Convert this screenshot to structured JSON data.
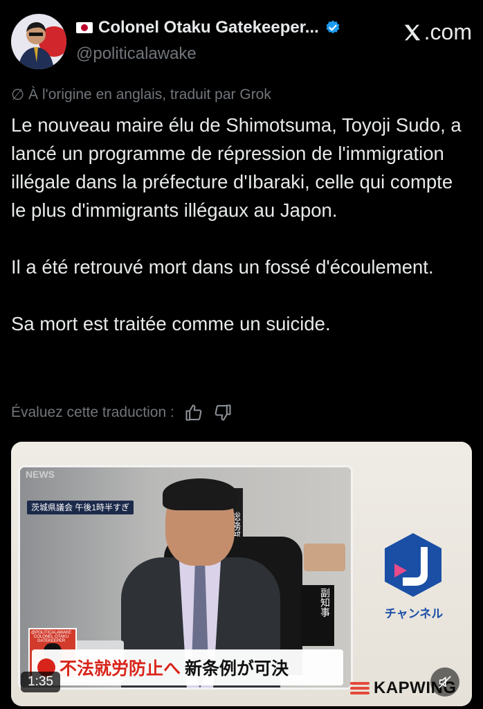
{
  "author": {
    "display_name": "Colonel Otaku Gatekeeper...",
    "handle": "@politicalawake",
    "verified": true,
    "flag": "japan-flag"
  },
  "brand": {
    "site": ".com"
  },
  "translation": {
    "note": "À l'origine en anglais, traduit par Grok",
    "rate_label": "Évaluez cette traduction :"
  },
  "tweet": {
    "paragraphs": [
      "Le nouveau maire élu de Shimotsuma, Toyoji Sudo, a lancé un programme de répression de l'immigration illégale dans la préfecture d'Ibaraki, celle qui compte le plus d'immigrants illégaux au Japon.",
      "Il a été retrouvé mort dans un fossé d'écoulement.",
      "Sa mort est traitée comme un suicide."
    ]
  },
  "media": {
    "duration": "1:35",
    "news_tag": "NEWS",
    "location_tag": "茨城県議会 午後1時半すぎ",
    "caption_red": "不法就労防止へ",
    "caption_black": "新条例が可決",
    "channel_label": "チャンネル",
    "watermark": "@POLITICALAWAKE COLONEL OTAKU GATEKEEPER",
    "nameplate": "副知事",
    "side_sign": "総務部",
    "kapwing": "KAPWING",
    "colors": {
      "accent_red": "#d9241b",
      "brand_blue": "#1b4fa6",
      "verified": "#1d9bf0"
    }
  }
}
